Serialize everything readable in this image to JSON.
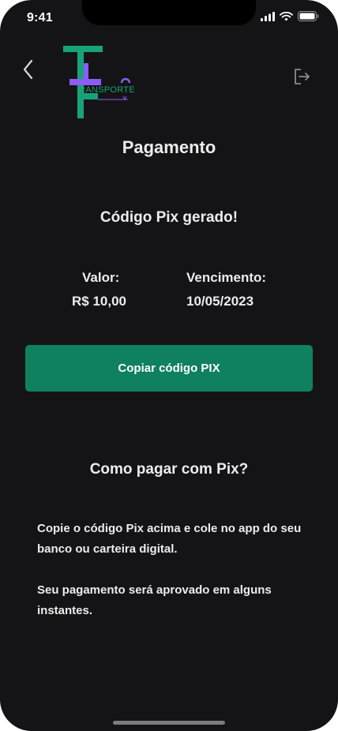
{
  "status_bar": {
    "time": "9:41"
  },
  "header": {
    "back_icon": "chevron-left-icon",
    "logout_icon": "logout-icon",
    "logo_text": "RANSPORTE"
  },
  "page": {
    "title": "Pagamento",
    "pix_heading": "Código Pix gerado!"
  },
  "payment": {
    "valor_label": "Valor:",
    "valor_value": "R$ 10,00",
    "vencimento_label": "Vencimento:",
    "vencimento_value": "10/05/2023"
  },
  "actions": {
    "copy_label": "Copiar código PIX"
  },
  "instructions": {
    "title": "Como pagar com Pix?",
    "paragraph1": "Copie o código Pix acima e cole no app do seu banco ou carteira digital.",
    "paragraph2": "Seu pagamento será aprovado em alguns instantes."
  },
  "colors": {
    "background": "#141416",
    "primary_button": "#0f8060",
    "logo_green": "#18a27a",
    "logo_purple": "#8b5cf6"
  }
}
